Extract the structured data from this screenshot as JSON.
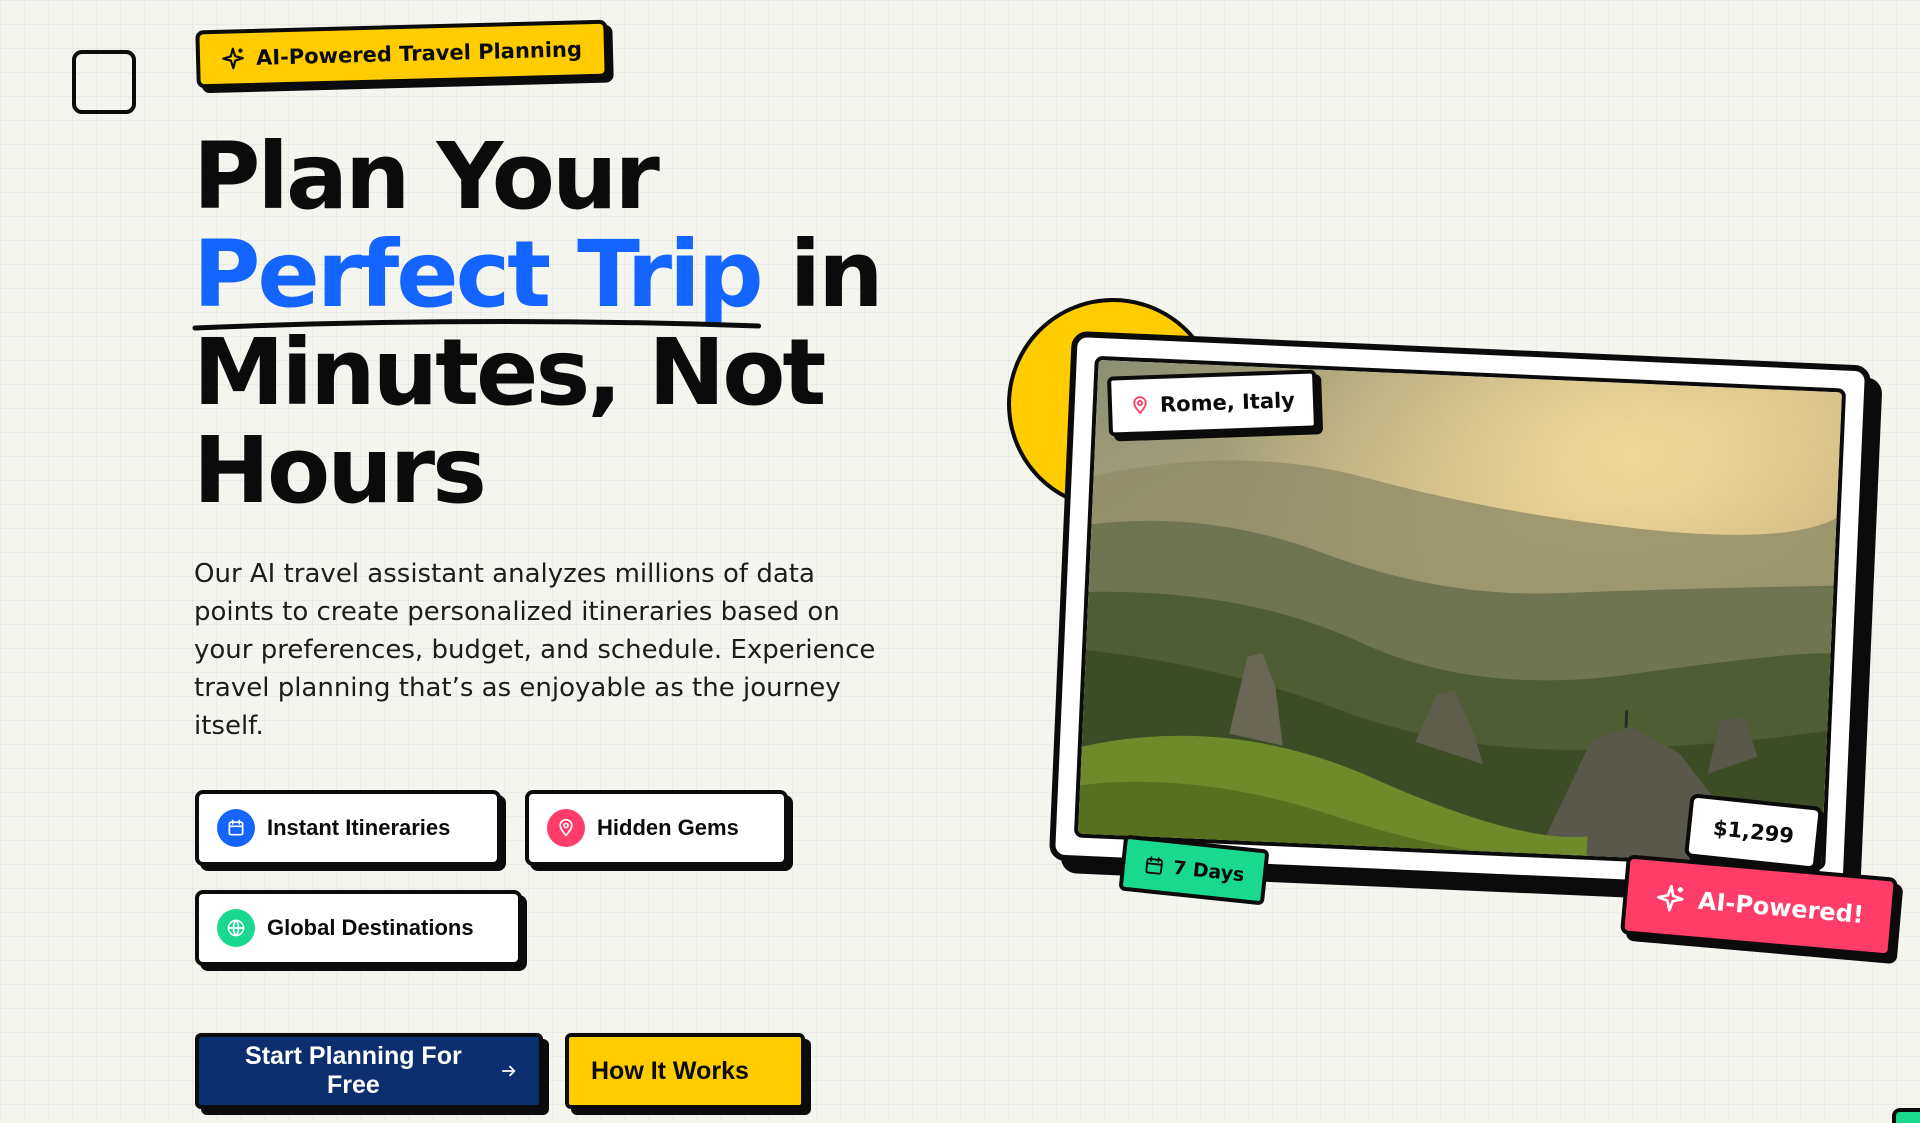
{
  "hero": {
    "tag_label": "AI-Powered Travel Planning",
    "headline": {
      "line1": "Plan Your",
      "accent": "Perfect Trip",
      "after_accent": " in",
      "line3": "Minutes, Not",
      "line4": "Hours"
    },
    "description": "Our AI travel assistant analyzes millions of data points to create personalized itineraries based on your preferences, budget, and schedule. Experience travel planning that’s as enjoyable as the journey itself.",
    "features": [
      {
        "label": "Instant Itineraries",
        "icon": "calendar-icon",
        "color": "#1464ff"
      },
      {
        "label": "Hidden Gems",
        "icon": "map-pin-icon",
        "color": "#ff3d68"
      },
      {
        "label": "Global Destinations",
        "icon": "globe-icon",
        "color": "#19d98f"
      }
    ],
    "cta_primary": "Start Planning For Free",
    "cta_secondary": "How It Works"
  },
  "card": {
    "location": "Rome, Italy",
    "price": "$1,299",
    "duration": "7 Days",
    "ai_badge": "AI-Powered!"
  },
  "colors": {
    "accent_blue": "#1464ff",
    "brand_yellow": "#ffcc00",
    "navy": "#0b2f6e",
    "pink": "#ff3d68",
    "green": "#19d98f",
    "background": "#f5f5f0"
  }
}
